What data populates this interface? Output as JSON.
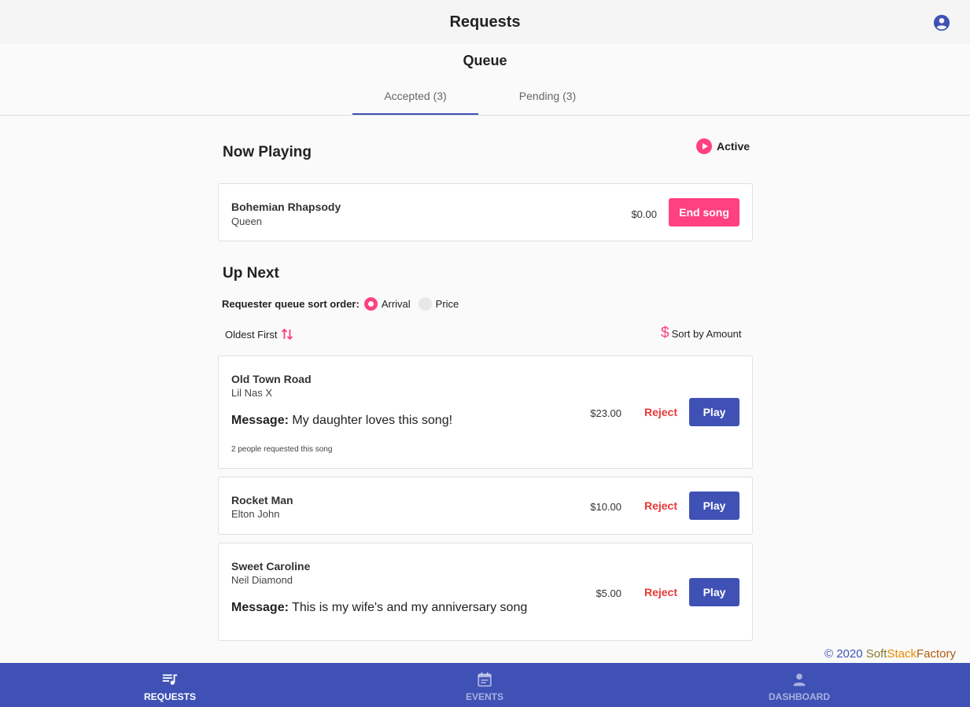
{
  "header": {
    "title": "Requests",
    "account_icon": "account-circle-icon"
  },
  "queue_title": "Queue",
  "tabs": [
    {
      "label": "Accepted (3)",
      "active": true
    },
    {
      "label": "Pending (3)",
      "active": false
    }
  ],
  "now_playing": {
    "heading": "Now Playing",
    "status": "Active",
    "song": {
      "title": "Bohemian Rhapsody",
      "artist": "Queen",
      "price": "$0.00",
      "action": "End song"
    }
  },
  "up_next": {
    "heading": "Up Next",
    "sort_label": "Requester queue sort order:",
    "sort_options": [
      {
        "label": "Arrival",
        "selected": true
      },
      {
        "label": "Price",
        "selected": false
      }
    ],
    "order_toggle": "Oldest First",
    "sort_by_amount": "Sort by Amount",
    "songs": [
      {
        "title": "Old Town Road",
        "artist": "Lil Nas X",
        "message_label": "Message:",
        "message": "My daughter loves this song!",
        "request_count": "2 people requested this song",
        "price": "$23.00",
        "reject": "Reject",
        "play": "Play"
      },
      {
        "title": "Rocket Man",
        "artist": "Elton John",
        "price": "$10.00",
        "reject": "Reject",
        "play": "Play"
      },
      {
        "title": "Sweet Caroline",
        "artist": "Neil Diamond",
        "message_label": "Message:",
        "message": "This is my wife's and my anniversary song",
        "price": "$5.00",
        "reject": "Reject",
        "play": "Play"
      }
    ]
  },
  "footer": {
    "copyright_prefix": "© 2020",
    "brand_part1": "Soft",
    "brand_part2": "Stack",
    "brand_part3": "Factory"
  },
  "bottom_nav": [
    {
      "label": "REQUESTS",
      "icon": "queue-music-icon",
      "active": true
    },
    {
      "label": "EVENTS",
      "icon": "calendar-icon",
      "active": false
    },
    {
      "label": "DASHBOARD",
      "icon": "person-icon",
      "active": false
    }
  ],
  "colors": {
    "primary": "#3f51b5",
    "accent": "#ff4081",
    "reject": "#e53935"
  }
}
